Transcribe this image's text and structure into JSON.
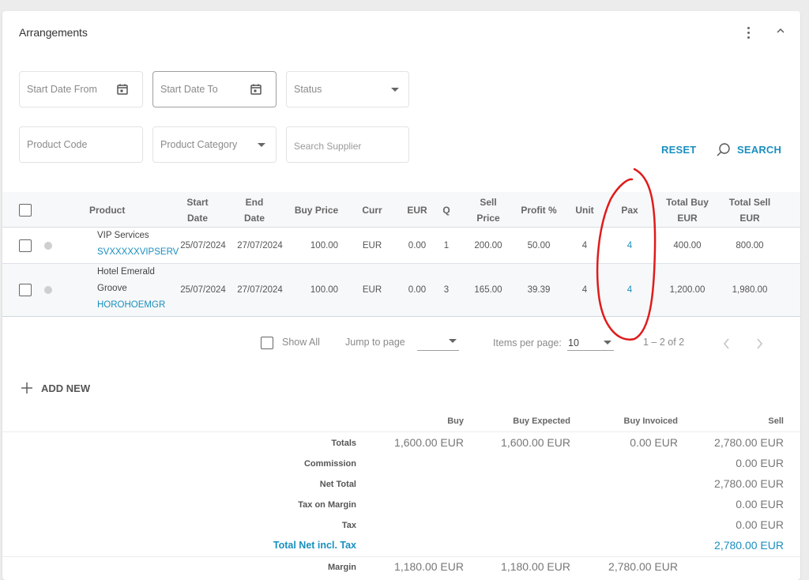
{
  "card": {
    "title": "Arrangements",
    "more_icon": "kebab-vertical-icon",
    "collapse_icon": "chevron-up-icon"
  },
  "filters": {
    "start_date_from": {
      "placeholder": "Start Date From",
      "value": "",
      "icon": "calendar-icon"
    },
    "start_date_to": {
      "placeholder": "Start Date To",
      "value": "",
      "icon": "calendar-icon"
    },
    "status": {
      "placeholder": "Status",
      "value": "",
      "icon": "caret-down-icon"
    },
    "product_code": {
      "placeholder": "Product Code",
      "value": ""
    },
    "product_category": {
      "placeholder": "Product Category",
      "value": "",
      "icon": "caret-down-icon"
    },
    "search_supplier": {
      "placeholder": "Search Supplier",
      "value": ""
    },
    "reset_label": "RESET",
    "search_label": "SEARCH"
  },
  "table": {
    "columns": {
      "product": "Product",
      "start_date_1": "Start",
      "start_date_2": "Date",
      "end_date_1": "End",
      "end_date_2": "Date",
      "buy_price": "Buy Price",
      "curr": "Curr",
      "eur": "EUR",
      "q": "Q",
      "sell_price_1": "Sell",
      "sell_price_2": "Price",
      "profit": "Profit %",
      "unit": "Unit",
      "pax": "Pax",
      "total_buy_1": "Total Buy",
      "total_buy_2": "EUR",
      "total_sell_1": "Total Sell",
      "total_sell_2": "EUR"
    },
    "rows": [
      {
        "product_name_1": "VIP Services",
        "product_name_2": "",
        "product_code": "SVXXXXXVIPSERV",
        "start_date": "25/07/2024",
        "end_date": "27/07/2024",
        "buy_price": "100.00",
        "curr": "EUR",
        "eur": "0.00",
        "q": "1",
        "sell_price": "200.00",
        "profit": "50.00",
        "unit": "4",
        "pax": "4",
        "total_buy": "400.00",
        "total_sell": "800.00",
        "checked": false
      },
      {
        "product_name_1": "Hotel Emerald",
        "product_name_2": "Groove",
        "product_code": "HOROHOEMGR",
        "start_date": "25/07/2024",
        "end_date": "27/07/2024",
        "buy_price": "100.00",
        "curr": "EUR",
        "eur": "0.00",
        "q": "3",
        "sell_price": "165.00",
        "profit": "39.39",
        "unit": "4",
        "pax": "4",
        "total_buy": "1,200.00",
        "total_sell": "1,980.00",
        "checked": false
      }
    ]
  },
  "pagination": {
    "show_all_label": "Show All",
    "jump_to_page_label": "Jump to page",
    "jump_to_page_value": "",
    "items_per_page_label": "Items per page:",
    "items_per_page_value": "10",
    "range_label": "1 – 2 of 2"
  },
  "add_new_label": "ADD NEW",
  "summary": {
    "headers": {
      "buy": "Buy",
      "buy_expected": "Buy Expected",
      "buy_invoiced": "Buy Invoiced",
      "sell": "Sell"
    },
    "rows": [
      {
        "label": "Totals",
        "buy": "1,600.00 EUR",
        "buy_expected": "1,600.00 EUR",
        "buy_invoiced": "0.00 EUR",
        "sell": "2,780.00 EUR"
      },
      {
        "label": "Commission",
        "buy": "",
        "buy_expected": "",
        "buy_invoiced": "",
        "sell": "0.00 EUR"
      },
      {
        "label": "Net Total",
        "buy": "",
        "buy_expected": "",
        "buy_invoiced": "",
        "sell": "2,780.00 EUR"
      },
      {
        "label": "Tax on Margin",
        "buy": "",
        "buy_expected": "",
        "buy_invoiced": "",
        "sell": "0.00 EUR"
      },
      {
        "label": "Tax",
        "buy": "",
        "buy_expected": "",
        "buy_invoiced": "",
        "sell": "0.00 EUR"
      },
      {
        "label": "Total Net incl. Tax",
        "buy": "",
        "buy_expected": "",
        "buy_invoiced": "",
        "sell": "2,780.00 EUR"
      },
      {
        "label": "Margin",
        "buy": "1,180.00 EUR",
        "buy_expected": "1,180.00 EUR",
        "buy_invoiced": "2,780.00 EUR",
        "sell": ""
      }
    ]
  },
  "colors": {
    "accent": "#1a8fc0",
    "annotation": "#e01b1b"
  }
}
